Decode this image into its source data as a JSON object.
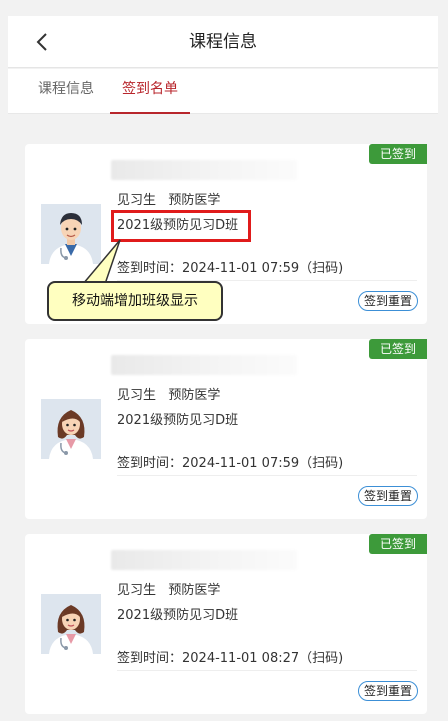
{
  "header": {
    "back_icon": "chevron-left-icon",
    "title": "课程信息"
  },
  "tabs": [
    {
      "label": "课程信息"
    },
    {
      "label": "签到名单"
    }
  ],
  "accent_color": "#b8262c",
  "badge_color": "#3d9a3a",
  "annotation": "移动端增加班级显示",
  "records": [
    {
      "status": "已签到",
      "role": "见习生",
      "major": "预防医学",
      "class": "2021级预防见习D班",
      "checkin": "签到时间：2024-11-01 07:59（扫码)",
      "reset_label": "签到重置",
      "avatar": "male-doctor-avatar"
    },
    {
      "status": "已签到",
      "role": "见习生",
      "major": "预防医学",
      "class": "2021级预防见习D班",
      "checkin": "签到时间：2024-11-01 07:59（扫码)",
      "reset_label": "签到重置",
      "avatar": "female-doctor-avatar"
    },
    {
      "status": "已签到",
      "role": "见习生",
      "major": "预防医学",
      "class": "2021级预防见习D班",
      "checkin": "签到时间：2024-11-01 08:27（扫码)",
      "reset_label": "签到重置",
      "avatar": "female-doctor-avatar"
    }
  ]
}
